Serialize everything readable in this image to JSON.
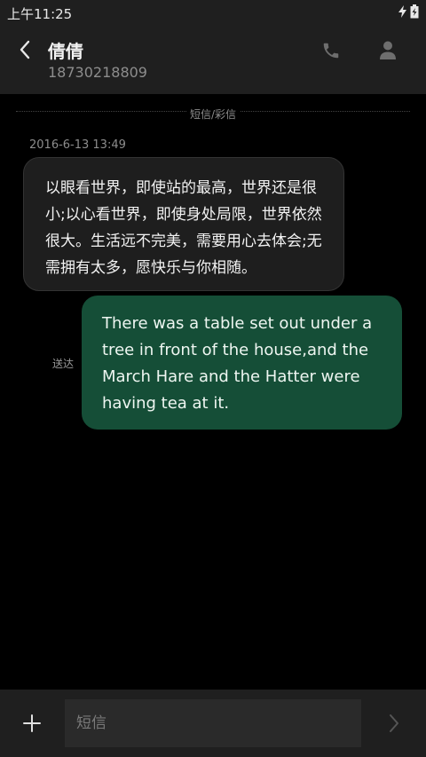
{
  "status_bar": {
    "time": "上午11:25",
    "icons": [
      "charging-bolt-icon",
      "battery-icon"
    ]
  },
  "header": {
    "contact_name": "倩倩",
    "contact_number": "18730218809",
    "icons": [
      "back-arrow-icon",
      "phone-icon",
      "person-icon"
    ]
  },
  "conversation": {
    "divider_label": "短信/彩信",
    "timestamp": "2016-6-13 13:49",
    "messages": [
      {
        "direction": "incoming",
        "text": "以眼看世界，即使站的最高，世界还是很小;以心看世界，即使身处局限，世界依然很大。生活远不完美，需要用心去体会;无需拥有太多，愿快乐与你相随。"
      },
      {
        "direction": "outgoing",
        "status": "送达",
        "text": "There was a table set out under a tree in front of the house,and the March Hare and the Hatter were having tea at it."
      }
    ]
  },
  "composer": {
    "placeholder": "短信",
    "icons": [
      "plus-icon",
      "send-chevron-icon"
    ]
  },
  "colors": {
    "background": "#000000",
    "bar_background": "#1f1f1f",
    "incoming_bubble": "#1e1e1e",
    "outgoing_bubble": "#154e37",
    "secondary_text": "#8d8d8d"
  }
}
